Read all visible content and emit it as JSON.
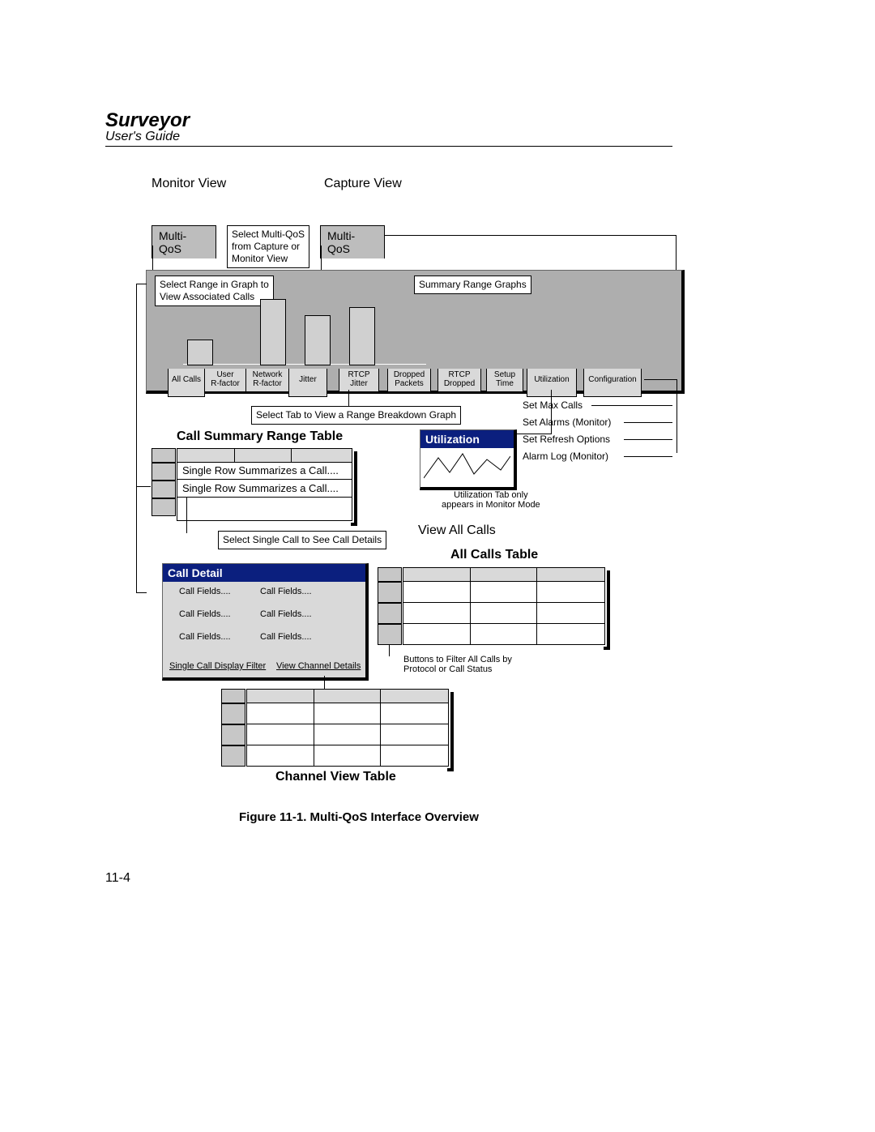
{
  "header": {
    "title": "Surveyor",
    "subtitle": "User's Guide",
    "page_number": "11-4"
  },
  "labels": {
    "monitor_view": "Monitor View",
    "capture_view": "Capture View",
    "multiqos": "Multi-QoS",
    "view_all_calls": "View All Calls"
  },
  "hints": {
    "select_multiqos": "Select Multi-QoS\nfrom Capture or\nMonitor View",
    "select_range": "Select Range in Graph to\nView Associated Calls",
    "summary_range": "Summary Range Graphs",
    "select_tab": "Select Tab to View a Range Breakdown Graph",
    "select_call": "Select Single Call to See Call Details",
    "buttons_filter": "Buttons to Filter All Calls by\nProtocol or Call Status",
    "util_note": "Utilization Tab only\nappears in Monitor Mode"
  },
  "sections": {
    "call_summary": "Call Summary Range Table",
    "all_calls": "All Calls Table",
    "channel_view": "Channel View Table",
    "call_detail": "Call Detail",
    "utilization": "Utilization"
  },
  "tabs": [
    "All Calls",
    "User\nR-factor",
    "Network\nR-factor",
    "Jitter",
    "RTCP\nJitter",
    "Dropped\nPackets",
    "RTCP\nDropped",
    "Setup\nTime",
    "Utilization",
    "Configuration"
  ],
  "config_menu": [
    "Set Max Calls",
    "Set Alarms (Monitor)",
    "Set Refresh Options",
    "Alarm Log (Monitor)"
  ],
  "summary_rows": [
    "Single Row Summarizes a Call....",
    "Single Row Summarizes a Call...."
  ],
  "call_detail_fields": "Call Fields....",
  "call_detail_links": {
    "filter": "Single Call Display Filter",
    "channel": "View Channel Details"
  },
  "caption": "Figure 11-1.  Multi-QoS Interface Overview"
}
